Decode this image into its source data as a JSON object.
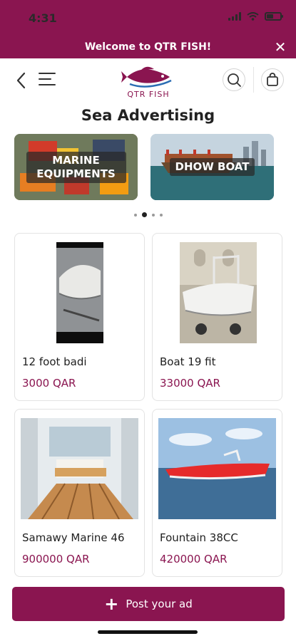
{
  "status_bar": {
    "time": "4:31"
  },
  "banner": {
    "text": "Welcome to QTR FISH!",
    "close_icon": "close-icon"
  },
  "header": {
    "logo_text": "QTR FISH",
    "icons": [
      "back-icon",
      "menu-icon",
      "search-icon",
      "bag-icon"
    ]
  },
  "page": {
    "title": "Sea Advertising"
  },
  "carousel": {
    "cards": [
      {
        "label": "MARINE EQUIPMENTS"
      },
      {
        "label": "DHOW BOAT"
      }
    ],
    "dots": 4,
    "active_dot": 2
  },
  "products": [
    {
      "name": "12 foot badi",
      "price": "3000 QAR"
    },
    {
      "name": "Boat 19 fit",
      "price": "33000 QAR"
    },
    {
      "name": "Samawy Marine 46",
      "price": "900000 QAR"
    },
    {
      "name": "Fountain 38CC",
      "price": "420000 QAR"
    }
  ],
  "post_button": {
    "label": "Post your ad"
  },
  "colors": {
    "brand": "#8a1550",
    "text": "#1f1f1f",
    "card_border": "#e3e3e3"
  }
}
